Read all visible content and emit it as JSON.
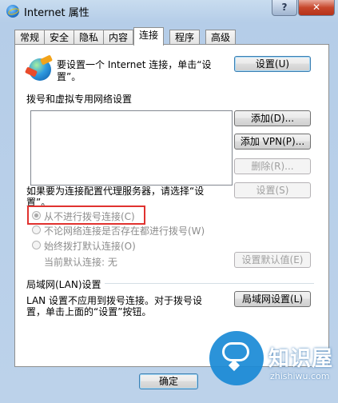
{
  "window": {
    "title": "Internet 属性",
    "help_label": "?",
    "close_label": "✕"
  },
  "tabs": [
    "常规",
    "安全",
    "隐私",
    "内容",
    "连接",
    "程序",
    "高级"
  ],
  "active_tab": "连接",
  "setup": {
    "text_line1": "要设置一个 Internet 连接，单击“设",
    "text_line2": "置”。",
    "button": "设置(U)",
    "icon": "network-globe-icon"
  },
  "dialup": {
    "heading": "拨号和虚拟专用网络设置",
    "add_button": "添加(D)...",
    "add_vpn_button": "添加 VPN(P)...",
    "delete_button": "删除(R)...",
    "proxy_text_line1": "如果要为连接配置代理服务器，请选择“设",
    "proxy_text_line2": "置”。",
    "settings_button": "设置(S)",
    "options": [
      {
        "label": "从不进行拨号连接(C)",
        "checked": true
      },
      {
        "label": "不论网络连接是否存在都进行拨号(W)",
        "checked": false
      },
      {
        "label": "始终拨打默认连接(O)",
        "checked": false
      }
    ],
    "current_default_label": "当前默认连接:",
    "current_default_value": "无",
    "set_default_button": "设置默认值(E)"
  },
  "lan": {
    "heading": "局域网(LAN)设置",
    "text_line1": "LAN 设置不应用到拨号连接。对于拨号设",
    "text_line2": "置，单击上面的“设置”按钮。",
    "button": "局域网设置(L)"
  },
  "footer": {
    "ok_button": "确定"
  },
  "watermark": {
    "brand": "知识屋",
    "url": "zhishiwu.com",
    "icon": "chat-bubble-icon"
  },
  "colors": {
    "highlight": "#e0322f",
    "watermark": "#1a8ad6"
  }
}
